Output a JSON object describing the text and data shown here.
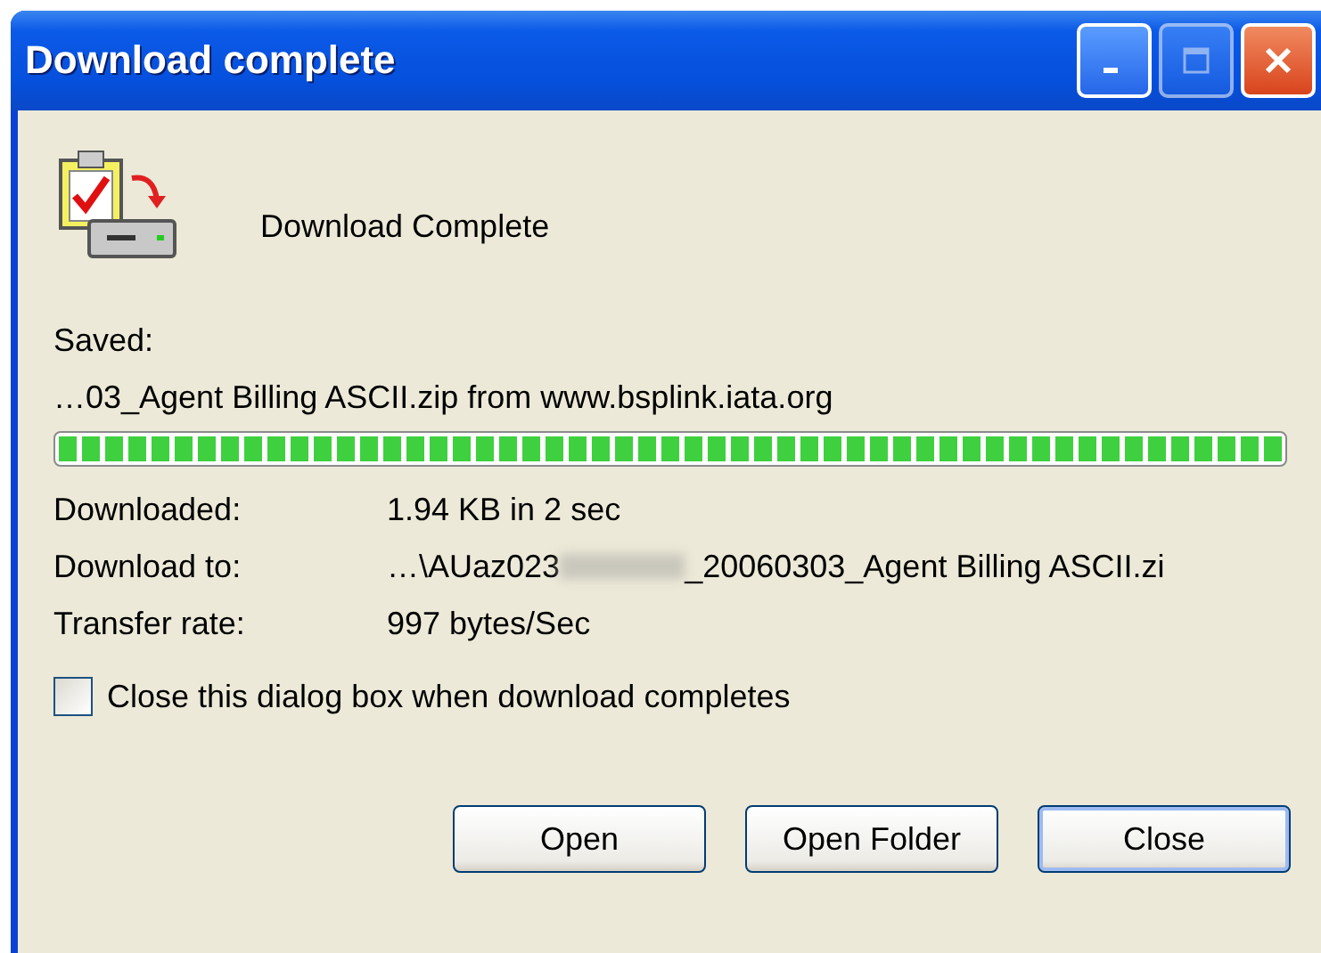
{
  "window": {
    "title": "Download complete",
    "maximize_disabled": true
  },
  "heading": "Download Complete",
  "saved_label": "Saved:",
  "saved_file": "…03_Agent Billing ASCII.zip from www.bsplink.iata.org",
  "progress": {
    "level": 1
  },
  "details": [
    {
      "label": "Downloaded:",
      "value": "1.94 KB in 2 sec"
    },
    {
      "label": "Download to:",
      "value": "…\\AUaz023",
      "value_end": "_20060303_Agent Billing ASCII.zi",
      "redacted": true
    },
    {
      "label": "Transfer rate:",
      "value": "997 bytes/Sec"
    }
  ],
  "close_when_done": {
    "label": "Close this dialog box when download completes",
    "checked": false
  },
  "buttons": [
    {
      "label": "Open",
      "default": false
    },
    {
      "label": "Open Folder",
      "default": false
    },
    {
      "label": "Close",
      "default": true
    }
  ]
}
